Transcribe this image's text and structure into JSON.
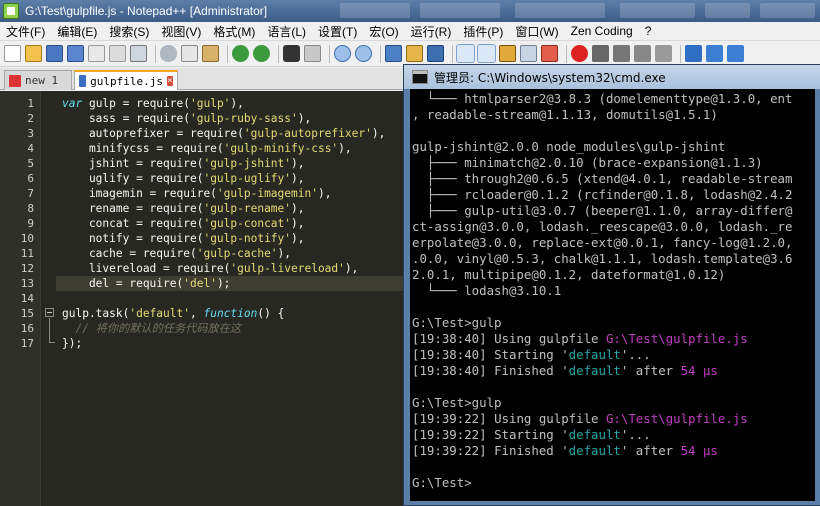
{
  "npp": {
    "title": "G:\\Test\\gulpfile.js - Notepad++ [Administrator]",
    "menu": [
      "文件(F)",
      "编辑(E)",
      "搜索(S)",
      "视图(V)",
      "格式(M)",
      "语言(L)",
      "设置(T)",
      "宏(O)",
      "运行(R)",
      "插件(P)",
      "窗口(W)",
      "Zen Coding",
      "?"
    ],
    "tabs": [
      {
        "label": "new 1",
        "active": false
      },
      {
        "label": "gulpfile.js",
        "active": true
      }
    ],
    "close_glyph": "×",
    "line_numbers": [
      "1",
      "2",
      "3",
      "4",
      "5",
      "6",
      "7",
      "8",
      "9",
      "10",
      "11",
      "12",
      "13",
      "14",
      "15",
      "16",
      "17"
    ],
    "code": {
      "l1_kw": "var",
      "l1_rest": " gulp = require(",
      "l1_str": "'gulp'",
      "l1_end": "),",
      "l2_a": "    sass = require(",
      "l2_str": "'gulp-ruby-sass'",
      "l2_end": "),",
      "l3_a": "    autoprefixer = require(",
      "l3_str": "'gulp-autoprefixer'",
      "l3_end": "),",
      "l4_a": "    minifycss = require(",
      "l4_str": "'gulp-minify-css'",
      "l4_end": "),",
      "l5_a": "    jshint = require(",
      "l5_str": "'gulp-jshint'",
      "l5_end": "),",
      "l6_a": "    uglify = require(",
      "l6_str": "'gulp-uglify'",
      "l6_end": "),",
      "l7_a": "    imagemin = require(",
      "l7_str": "'gulp-imagemin'",
      "l7_end": "),",
      "l8_a": "    rename = require(",
      "l8_str": "'gulp-rename'",
      "l8_end": "),",
      "l9_a": "    concat = require(",
      "l9_str": "'gulp-concat'",
      "l9_end": "),",
      "l10_a": "    notify = require(",
      "l10_str": "'gulp-notify'",
      "l10_end": "),",
      "l11_a": "    cache = require(",
      "l11_str": "'gulp-cache'",
      "l11_end": "),",
      "l12_a": "    livereload = require(",
      "l12_str": "'gulp-livereload'",
      "l12_end": "),",
      "l13_a": "    del = require(",
      "l13_str": "'del'",
      "l13_end": ");",
      "l15_a": "gulp.task(",
      "l15_str": "'default'",
      "l15_mid": ", ",
      "l15_kw": "function",
      "l15_end": "() {",
      "l16_cm": "  // 将你的默认的任务代码放在这",
      "l17": "});"
    }
  },
  "cmd": {
    "title": "管理员: C:\\Windows\\system32\\cmd.exe",
    "lines": [
      "  └─── htmlparser2@3.8.3 (domelementtype@1.3.0, ent",
      ", readable-stream@1.1.13, domutils@1.5.1)",
      "",
      "gulp-jshint@2.0.0 node_modules\\gulp-jshint",
      "  ├─── minimatch@2.0.10 (brace-expansion@1.1.3)",
      "  ├─── through2@0.6.5 (xtend@4.0.1, readable-stream",
      "  ├─── rcloader@0.1.2 (rcfinder@0.1.8, lodash@2.4.2",
      "  ├─── gulp-util@3.0.7 (beeper@1.1.0, array-differ@",
      "ct-assign@3.0.0, lodash._reescape@3.0.0, lodash._re",
      "erpolate@3.0.0, replace-ext@0.0.1, fancy-log@1.2.0,",
      ".0.0, vinyl@0.5.3, chalk@1.1.1, lodash.template@3.6",
      "2.0.1, multipipe@0.1.2, dateformat@1.0.12)",
      "  └─── lodash@3.10.1",
      "",
      "G:\\Test>gulp"
    ],
    "run1": {
      "t1": "[19:38:40]",
      "using": " Using gulpfile ",
      "path": "G:\\Test\\gulpfile.js",
      "t2": "[19:38:40]",
      "starting": " Starting '",
      "task": "default",
      "dots": "'...",
      "t3": "[19:38:40]",
      "finished": " Finished '",
      "after": "' after ",
      "dur": "54 μs"
    },
    "prompt2": "G:\\Test>gulp",
    "run2": {
      "t1": "[19:39:22]",
      "using": " Using gulpfile ",
      "path": "G:\\Test\\gulpfile.js",
      "t2": "[19:39:22]",
      "starting": " Starting '",
      "task": "default",
      "dots": "'...",
      "t3": "[19:39:22]",
      "finished": " Finished '",
      "after": "' after ",
      "dur": "54 μs"
    },
    "prompt3": "G:\\Test>"
  },
  "colors": {
    "editor_bg": "#272822",
    "keyword": "#66d9ef",
    "string": "#e6db74",
    "comment": "#75715e",
    "cmd_magenta": "#c03dc0",
    "cmd_cyan": "#26a5a5"
  }
}
